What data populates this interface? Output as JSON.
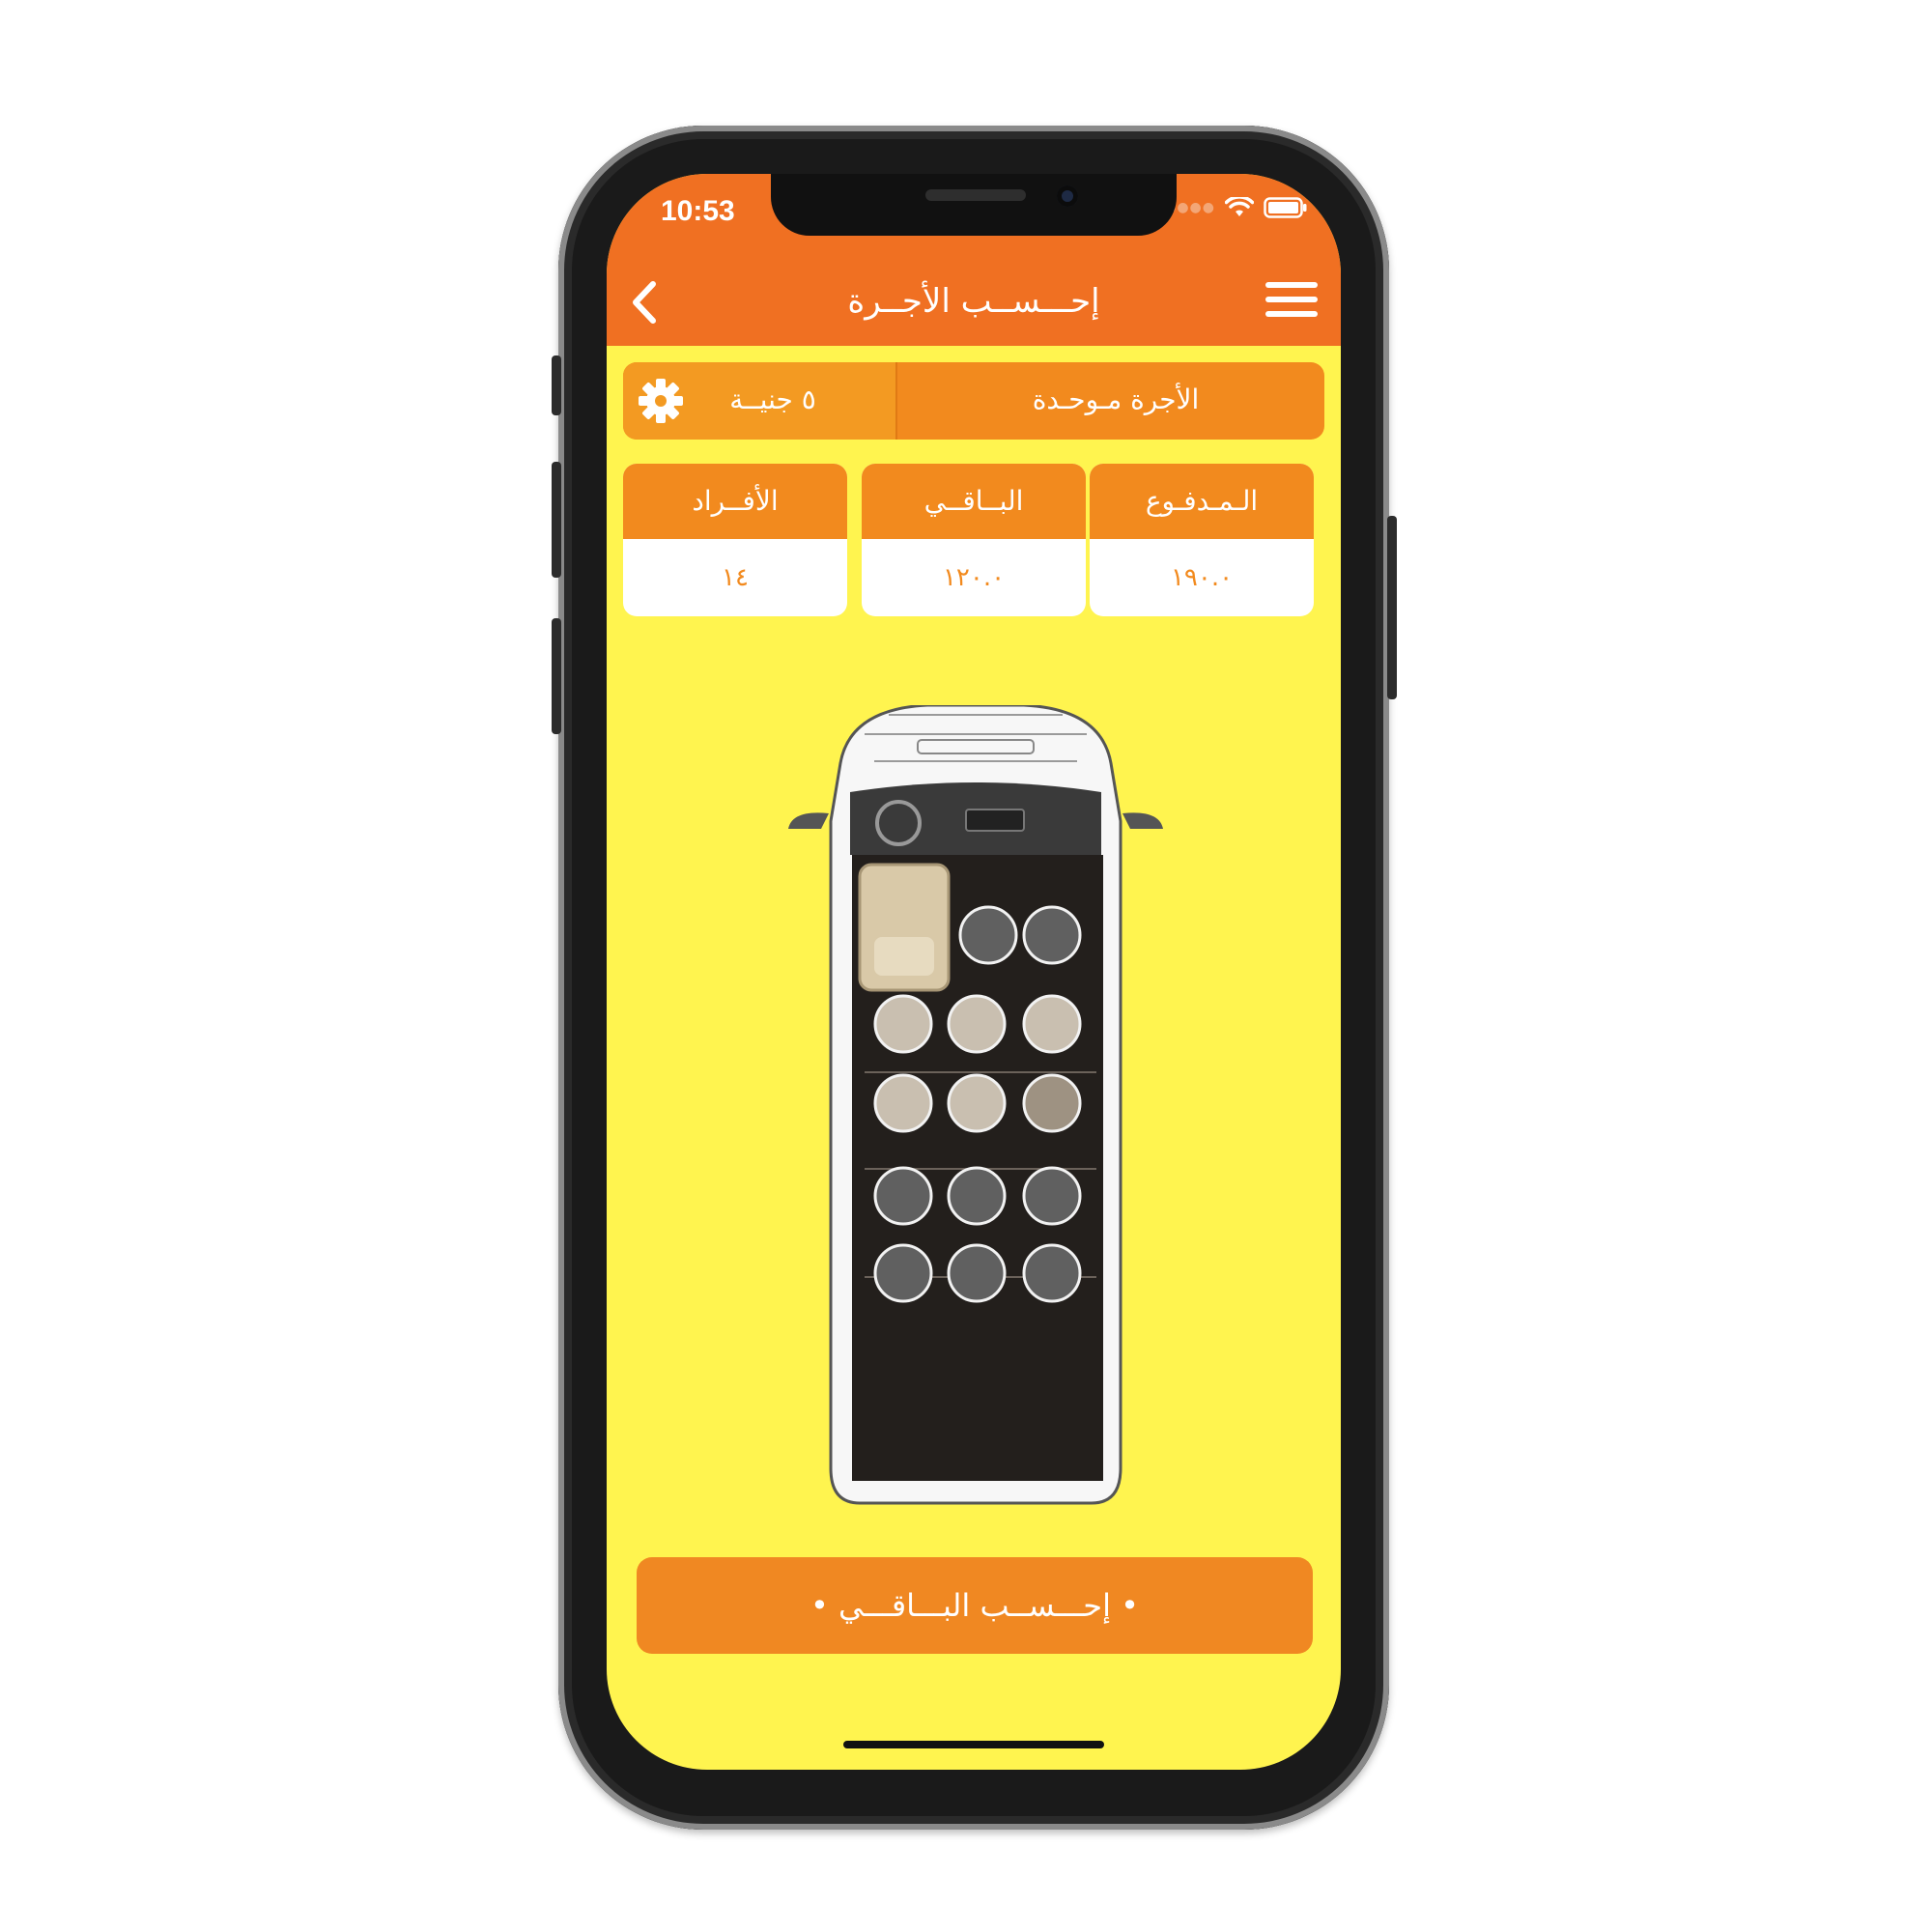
{
  "status_bar": {
    "time": "10:53"
  },
  "nav": {
    "title": "إحـــســب الأجــرة",
    "back_icon": "chevron-left-icon",
    "menu_icon": "hamburger-menu-icon"
  },
  "fare": {
    "label": "الأجرة مـوحـدة",
    "amount": "٥ جنيــة",
    "settings_icon": "gear-icon"
  },
  "stats": [
    {
      "label": "الـمـدفـوع",
      "value": "١٩٠.٠"
    },
    {
      "label": "البــاقــي",
      "value": "١٢٠.٠"
    },
    {
      "label": "الأفــراد",
      "value": "١٤"
    }
  ],
  "seats": {
    "total": 15,
    "rows": [
      [
        "dark",
        "dark"
      ],
      [
        "light",
        "light",
        "light"
      ],
      [
        "light",
        "light",
        "tan"
      ],
      [
        "dark",
        "dark",
        "dark"
      ],
      [
        "dark",
        "dark",
        "dark"
      ]
    ]
  },
  "action_button": {
    "label": "•  إحـــســب البـــاقـــي  •"
  },
  "colors": {
    "header": "#f07022",
    "accent": "#f28a1e",
    "background": "#fff44f",
    "seat_dark": "#606060",
    "seat_light": "#c9bfb0",
    "seat_tan": "#9e9282"
  }
}
